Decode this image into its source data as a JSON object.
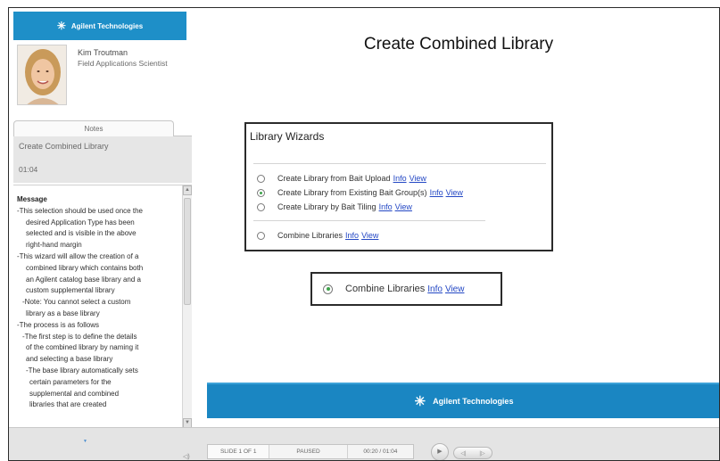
{
  "sidebar": {
    "logo_text": "Agilent Technologies",
    "presenter": {
      "name": "Kim Troutman",
      "title": "Field Applications Scientist"
    },
    "notes_tab_label": "Notes",
    "current_slide_title": "Create Combined Library",
    "current_slide_duration": "01:04",
    "notes_lines": [
      {
        "text": "Message",
        "indent": 0,
        "heading": true
      },
      {
        "text": "-This selection should be used once the",
        "indent": 0
      },
      {
        "text": "desired Application Type has been",
        "indent": 2
      },
      {
        "text": "selected and is visible in the above",
        "indent": 2
      },
      {
        "text": "right-hand margin",
        "indent": 2
      },
      {
        "text": "-This wizard will allow the creation of a",
        "indent": 0
      },
      {
        "text": "combined library which contains both",
        "indent": 2
      },
      {
        "text": "an Agilent catalog base library and a",
        "indent": 2
      },
      {
        "text": "custom supplemental library",
        "indent": 2
      },
      {
        "text": "-Note: You cannot select a custom",
        "indent": 1
      },
      {
        "text": "library as a base library",
        "indent": 2
      },
      {
        "text": "-The process is as follows",
        "indent": 0
      },
      {
        "text": "-The first step is to define the details",
        "indent": 1
      },
      {
        "text": "of the combined library by naming it",
        "indent": 2
      },
      {
        "text": "and selecting a base library",
        "indent": 2
      },
      {
        "text": "-The base library automatically sets",
        "indent": 2
      },
      {
        "text": "certain parameters for the",
        "indent": 3
      },
      {
        "text": "supplemental and combined",
        "indent": 3
      },
      {
        "text": "libraries that are created",
        "indent": 3
      }
    ]
  },
  "slide": {
    "title": "Create Combined Library",
    "wizard": {
      "title": "Library Wizards",
      "options": [
        {
          "label": "Create Library from Bait Upload",
          "info": "Info",
          "view": "View",
          "selected": false
        },
        {
          "label": "Create Library from Existing Bait Group(s)",
          "info": "Info",
          "view": "View",
          "selected": true
        },
        {
          "label": "Create Library by Bait Tiling",
          "info": "Info",
          "view": "View",
          "selected": false
        },
        {
          "label": "Combine Libraries",
          "info": "Info",
          "view": "View",
          "selected": false
        }
      ]
    },
    "callout": {
      "label": "Combine Libraries",
      "info": "Info",
      "view": "View",
      "selected": true
    },
    "footer_logo_text": "Agilent Technologies",
    "colors": {
      "brand_blue": "#1a86c2",
      "link_blue": "#2347c4",
      "radio_selected": "#3ea34b"
    }
  },
  "player": {
    "volume_icon": "◁)",
    "slide_counter": "SLIDE 1 OF 1",
    "state": "PAUSED",
    "time": "00:20 / 01:04",
    "play_icon": "▶",
    "prev_icon": "◁|",
    "next_icon": "|▷"
  }
}
